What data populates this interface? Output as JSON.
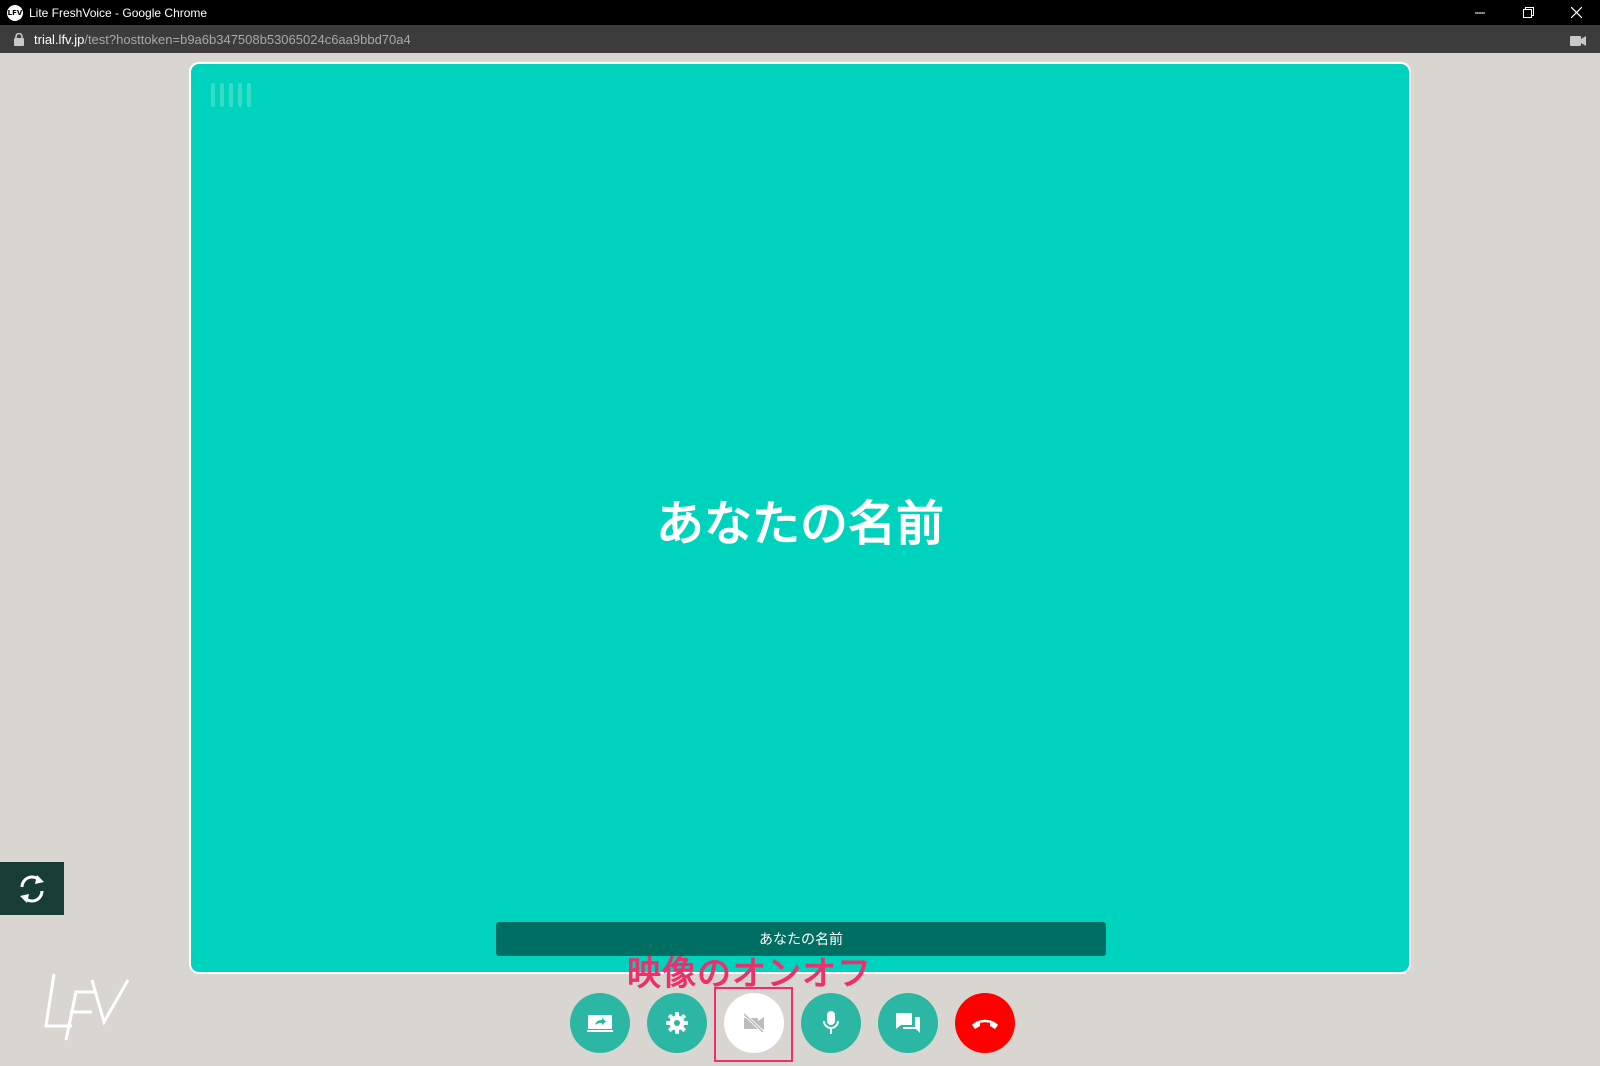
{
  "window": {
    "title": "Lite FreshVoice - Google Chrome",
    "app_icon": "LFV"
  },
  "address_bar": {
    "host": "trial.lfv.jp",
    "path": "/test?hosttoken=b9a6b347508b53065024c6aa9bbd70a4"
  },
  "stage": {
    "participant_name": "あなたの名前",
    "name_label": "あなたの名前"
  },
  "annotation": {
    "text": "映像のオンオフ",
    "color": "#ee2f6b"
  },
  "controls": [
    {
      "name": "screen-share-button",
      "icon": "screen-share-icon"
    },
    {
      "name": "settings-button",
      "icon": "gear-icon"
    },
    {
      "name": "video-toggle-button",
      "icon": "video-off-icon",
      "state": "off"
    },
    {
      "name": "mic-button",
      "icon": "mic-icon"
    },
    {
      "name": "chat-button",
      "icon": "chat-icon"
    },
    {
      "name": "hangup-button",
      "icon": "phone-hangup-icon"
    }
  ],
  "colors": {
    "stage_bg": "#00d3bd",
    "control_bg": "#2bb7a4",
    "hangup": "#ff0000",
    "name_bar": "#006e62"
  }
}
